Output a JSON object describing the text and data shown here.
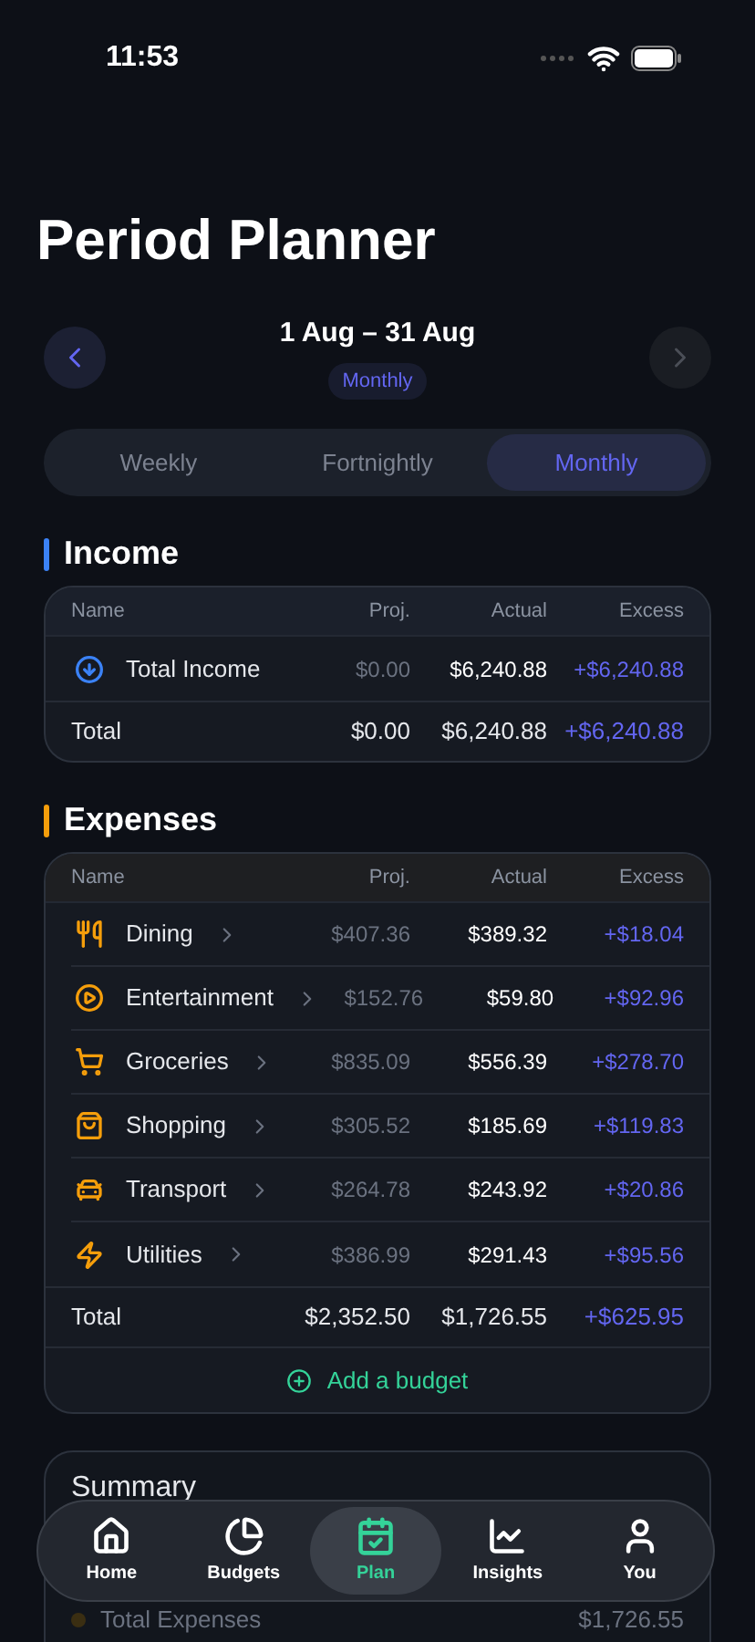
{
  "status_bar": {
    "time": "11:53"
  },
  "title": "Period Planner",
  "period": {
    "range": "1 Aug – 31 Aug",
    "badge": "Monthly",
    "prev": {
      "disabled": false
    },
    "next": {
      "disabled": true
    }
  },
  "tabs": [
    {
      "label": "Weekly",
      "selected": false
    },
    {
      "label": "Fortnightly",
      "selected": false
    },
    {
      "label": "Monthly",
      "selected": true
    }
  ],
  "income": {
    "title": "Income",
    "color": "#3b82f6",
    "columns": [
      "Name",
      "Proj.",
      "Actual",
      "Excess"
    ],
    "rows": [
      {
        "kind": "income",
        "name": "Total Income",
        "proj": "$0.00",
        "actual": "$6,240.88",
        "excess": "+$6,240.88"
      }
    ],
    "total": {
      "label": "Total",
      "proj": "$0.00",
      "actual": "$6,240.88",
      "excess": "+$6,240.88"
    }
  },
  "expenses": {
    "title": "Expenses",
    "color": "#f59e0b",
    "columns": [
      "Name",
      "Proj.",
      "Actual",
      "Excess"
    ],
    "rows": [
      {
        "kind": "dining",
        "name": "Dining",
        "proj": "$407.36",
        "actual": "$389.32",
        "excess": "+$18.04",
        "chevron": true
      },
      {
        "kind": "entertainment",
        "name": "Entertainment",
        "proj": "$152.76",
        "actual": "$59.80",
        "excess": "+$92.96",
        "chevron": true
      },
      {
        "kind": "groceries",
        "name": "Groceries",
        "proj": "$835.09",
        "actual": "$556.39",
        "excess": "+$278.70",
        "chevron": true
      },
      {
        "kind": "shopping",
        "name": "Shopping",
        "proj": "$305.52",
        "actual": "$185.69",
        "excess": "+$119.83",
        "chevron": true
      },
      {
        "kind": "transport",
        "name": "Transport",
        "proj": "$264.78",
        "actual": "$243.92",
        "excess": "+$20.86",
        "chevron": true
      },
      {
        "kind": "utilities",
        "name": "Utilities",
        "proj": "$386.99",
        "actual": "$291.43",
        "excess": "+$95.56",
        "chevron": true
      }
    ],
    "total": {
      "label": "Total",
      "proj": "$2,352.50",
      "actual": "$1,726.55",
      "excess": "+$625.95"
    },
    "add_button": "Add a budget"
  },
  "summary": {
    "title": "Summary",
    "rows": [
      {
        "label": "Total Expenses",
        "value": "$1,726.55",
        "color": "#3a2e12"
      }
    ]
  },
  "nav": [
    {
      "kind": "home",
      "label": "Home",
      "selected": false
    },
    {
      "kind": "budgets",
      "label": "Budgets",
      "selected": false
    },
    {
      "kind": "plan",
      "label": "Plan",
      "selected": true
    },
    {
      "kind": "insights",
      "label": "Insights",
      "selected": false
    },
    {
      "kind": "you",
      "label": "You",
      "selected": false
    }
  ]
}
